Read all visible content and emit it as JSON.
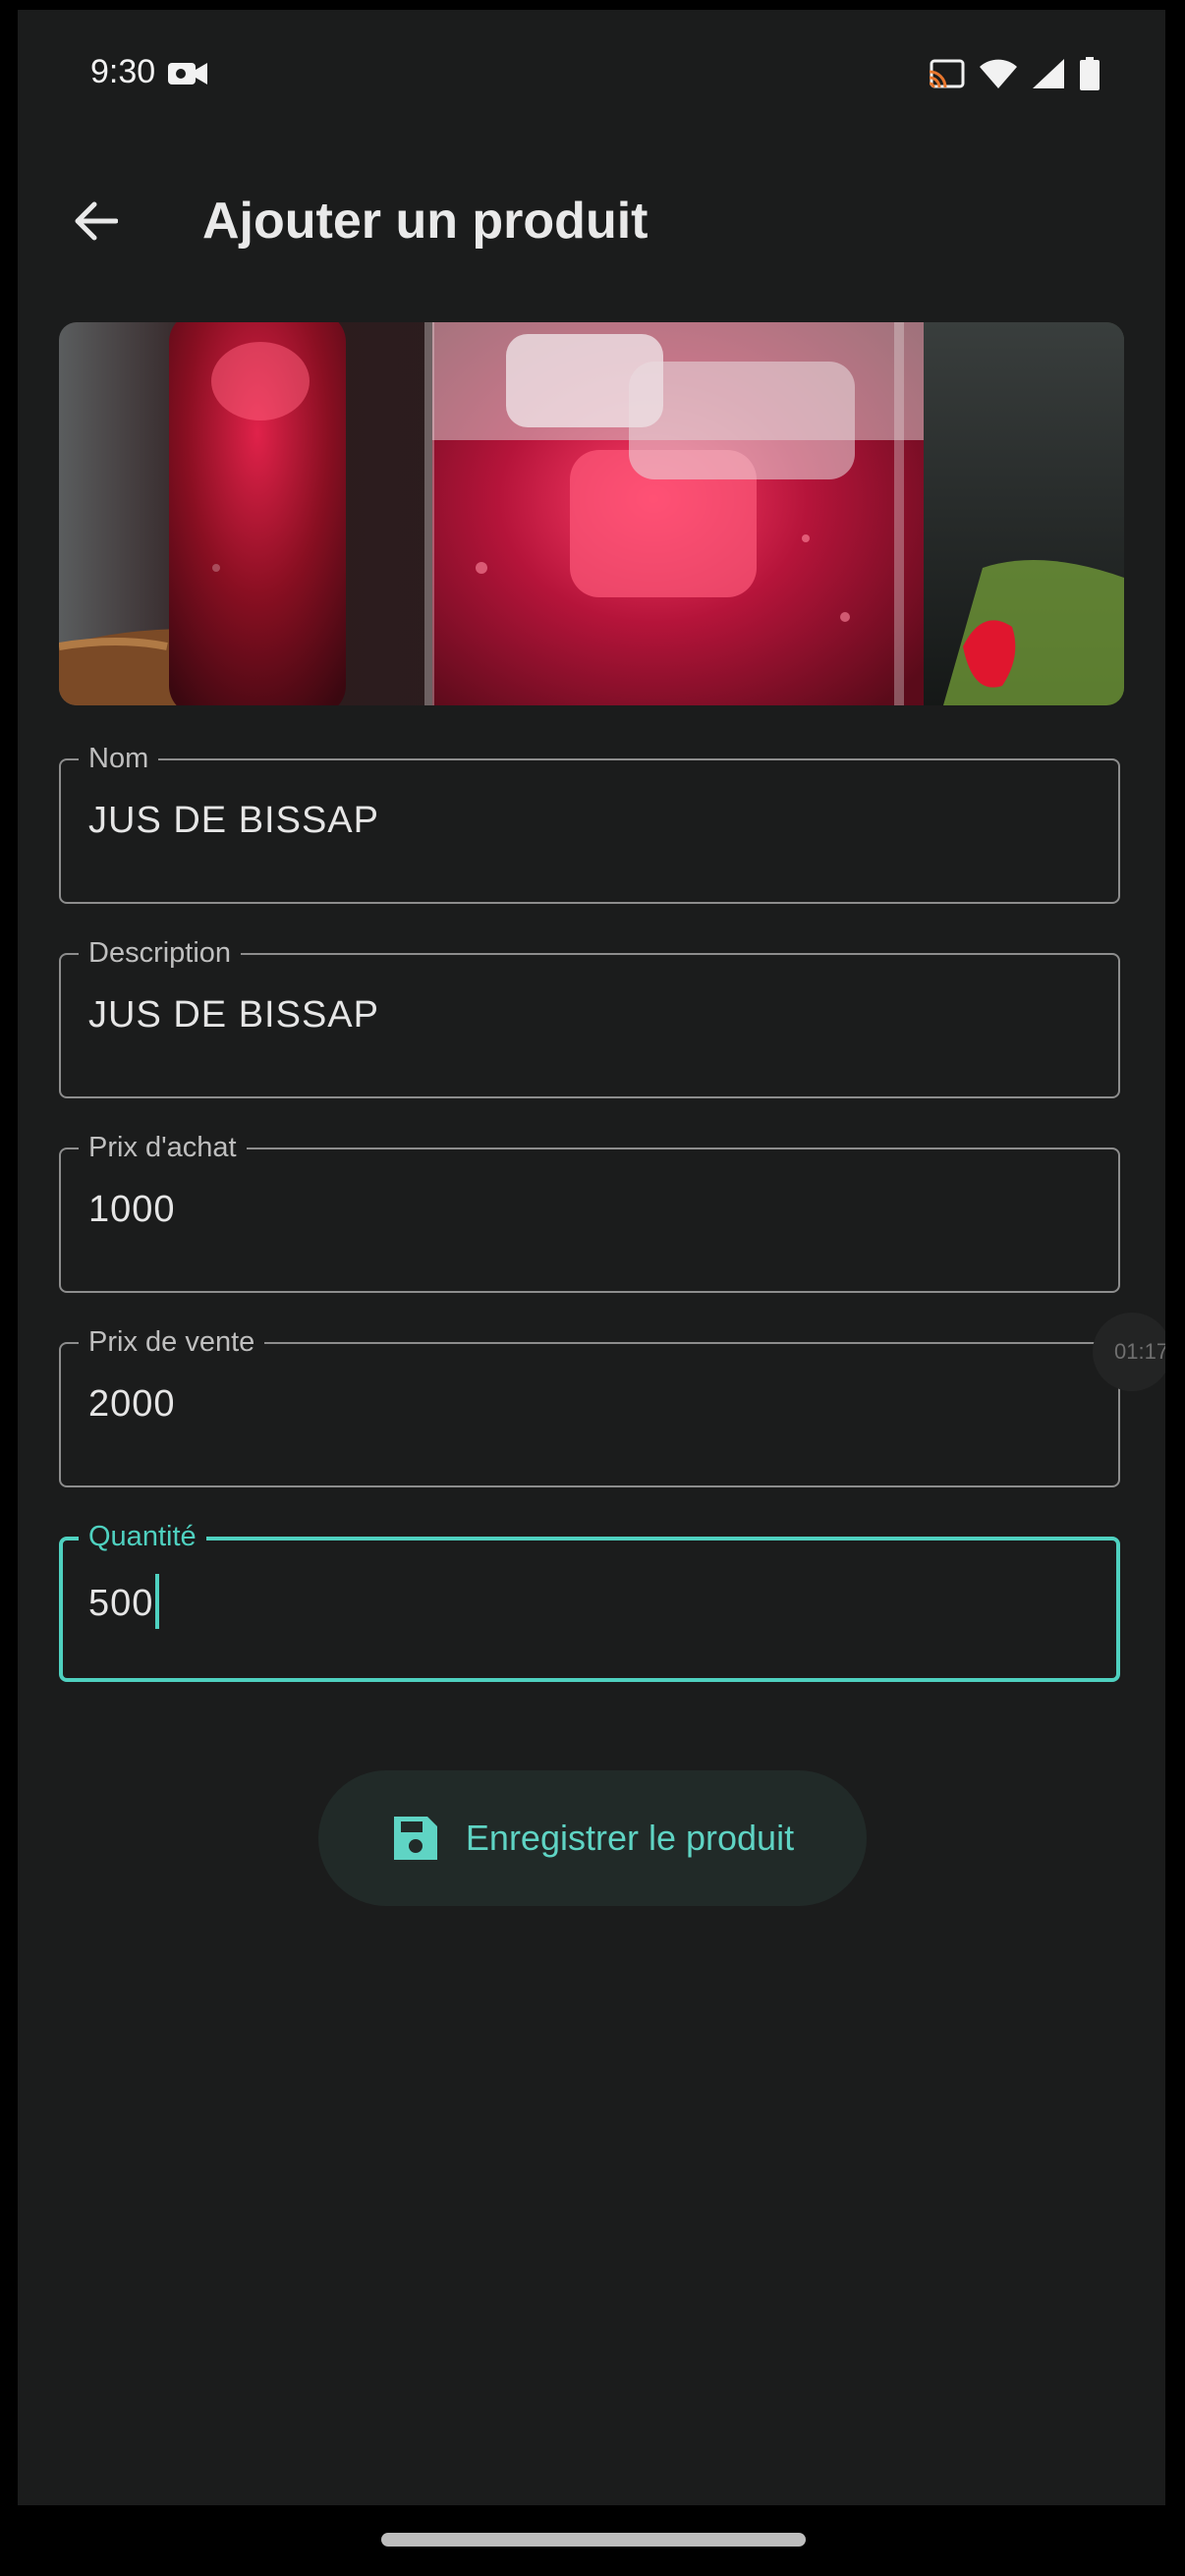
{
  "status_bar": {
    "time": "9:30"
  },
  "app_bar": {
    "title": "Ajouter un produit"
  },
  "product_image": {
    "alt": "glasses of red bissap juice with ice"
  },
  "form": {
    "fields": [
      {
        "label": "Nom",
        "value": "JUS DE BISSAP"
      },
      {
        "label": "Description",
        "value": "JUS DE BISSAP"
      },
      {
        "label": "Prix d'achat",
        "value": "1000"
      },
      {
        "label": "Prix de vente",
        "value": "2000"
      },
      {
        "label": "Quantité",
        "value": "500",
        "focused": true
      }
    ]
  },
  "overlay": {
    "timer": "01:17"
  },
  "actions": {
    "save_label": "Enregistrer le produit"
  },
  "colors": {
    "accent": "#4fd1c0",
    "background": "#1b1c1c"
  }
}
